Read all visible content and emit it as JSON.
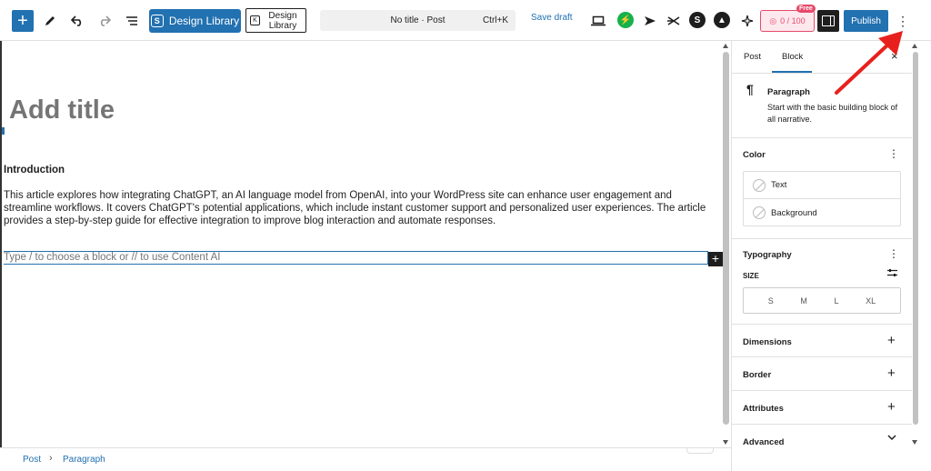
{
  "toolbar": {
    "inserter_icon": "+",
    "design_library_label": "Design Library",
    "design_library_short": "S",
    "design_library2_label": "Design Library",
    "design_library2_short": "K",
    "command_bar_title": "No title · Post",
    "command_bar_shortcut": "Ctrl+K",
    "save_draft_label": "Save draft",
    "ai_counter": "0 / 100",
    "ai_badge_tag": "Free",
    "publish_label": "Publish",
    "more_icon": "⋮",
    "colors": {
      "accent": "#2271b1",
      "ai": "#e64a6b",
      "green": "#17b14c",
      "dark": "#1e1e1e"
    }
  },
  "editor": {
    "title_placeholder": "Add title",
    "heading": "Introduction",
    "paragraph": "This article explores how integrating ChatGPT, an AI language model from OpenAI, into your WordPress site can enhance user engagement and streamline workflows. It covers ChatGPT's potential applications, which include instant customer support and personalized user experiences. The article provides a step-by-step guide for effective integration to improve blog interaction and automate responses.",
    "empty_block_placeholder": "Type / to choose a block or // to use Content AI",
    "block_plus": "+"
  },
  "sidebar": {
    "tabs": [
      {
        "label": "Post"
      },
      {
        "label": "Block"
      }
    ],
    "active_tab": "Block",
    "close_icon": "×",
    "block_card": {
      "icon": "¶",
      "name": "Paragraph",
      "description": "Start with the basic building block of all narrative."
    },
    "color": {
      "title": "Color",
      "items": [
        {
          "label": "Text"
        },
        {
          "label": "Background"
        }
      ]
    },
    "typography": {
      "title": "Typography",
      "size_label": "SIZE",
      "sizes": [
        "S",
        "M",
        "L",
        "XL"
      ]
    },
    "panels": [
      {
        "label": "Dimensions",
        "icon": "+"
      },
      {
        "label": "Border",
        "icon": "+"
      },
      {
        "label": "Attributes",
        "icon": "+"
      },
      {
        "label": "Advanced",
        "icon": "⌄"
      }
    ],
    "kebab_icon": "⋮"
  },
  "footer": {
    "breadcrumbs": [
      "Post",
      "Paragraph"
    ],
    "separator": "›"
  }
}
